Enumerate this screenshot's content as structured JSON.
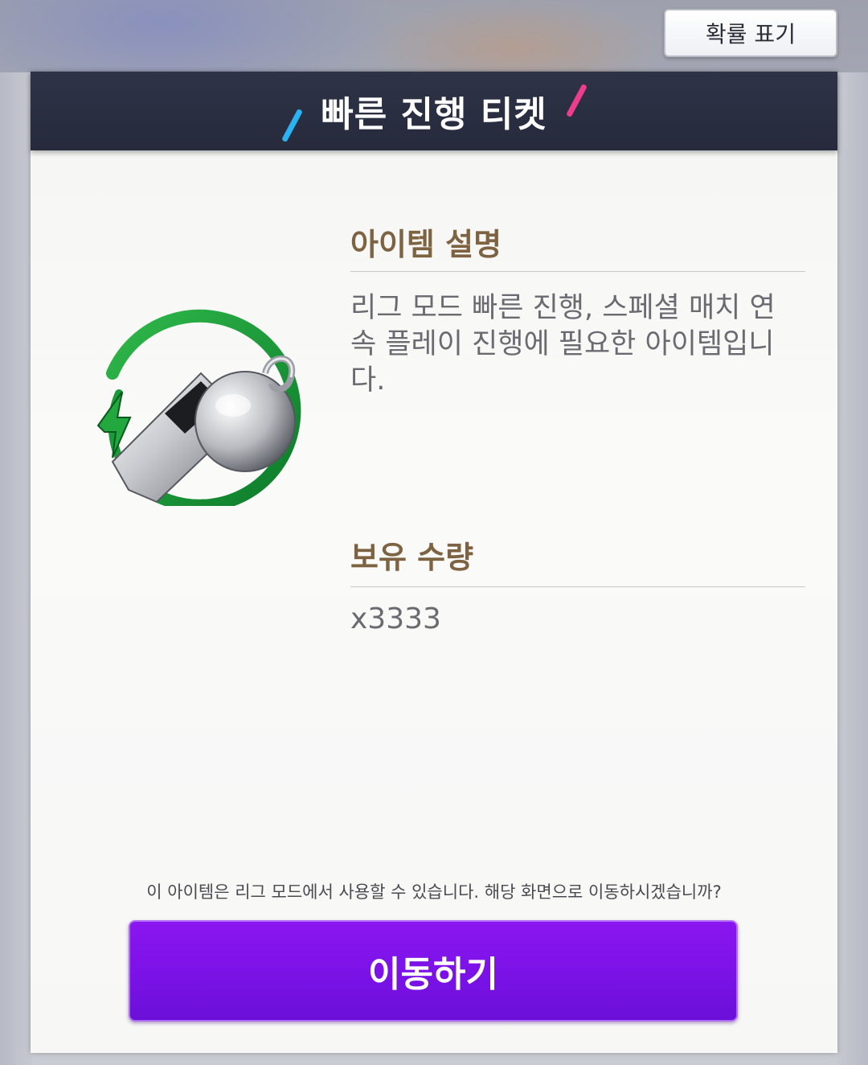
{
  "top_button": {
    "label": "확률 표기"
  },
  "modal": {
    "title": "빠른 진행 티켓",
    "item_icon": "whistle-fast-forward-icon",
    "description": {
      "heading": "아이템 설명",
      "text": "리그 모드 빠른 진행, 스페셜 매치 연속 플레이 진행에 필요한 아이템입니다."
    },
    "quantity": {
      "heading": "보유 수량",
      "value": "x3333"
    },
    "notice": "이 아이템은 리그 모드에서 사용할 수 있습니다. 해당 화면으로 이동하시겠습니까?",
    "action_button": {
      "label": "이동하기"
    }
  },
  "colors": {
    "header_bg": "#2a2f42",
    "accent_blue": "#2bb2f0",
    "accent_pink": "#ee3d8c",
    "heading_brown": "#7d6342",
    "button_purple": "#7a12e6"
  }
}
